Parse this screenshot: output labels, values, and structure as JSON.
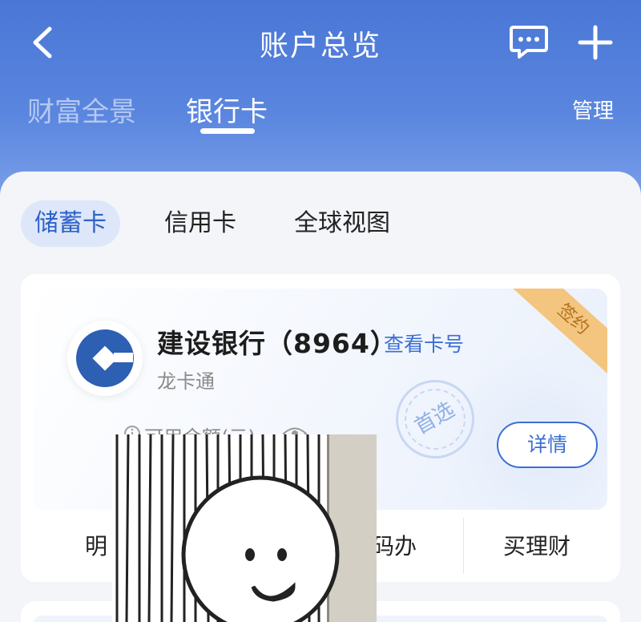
{
  "header": {
    "title": "账户总览",
    "tabs": [
      "财富全景",
      "银行卡"
    ],
    "active_tab": "银行卡",
    "manage_label": "管理"
  },
  "segments": {
    "items": [
      "储蓄卡",
      "信用卡",
      "全球视图"
    ],
    "active": "储蓄卡"
  },
  "card": {
    "bank_name": "建设银行（8964）",
    "view_card_number": "查看卡号",
    "card_type": "龙卡通",
    "badge": "签约",
    "stamp": "首选",
    "balance_label": "可用余额(元)",
    "detail_button": "详情",
    "actions": [
      "明细",
      "扫码办",
      "买理财"
    ],
    "visible_action_text": [
      "明",
      "扫码办",
      "买理财"
    ]
  },
  "colors": {
    "header_blue": "#4a77d6",
    "accent": "#3b6fd3",
    "badge": "#f3c57e"
  },
  "icons": {
    "back": "chevron-left-icon",
    "message": "message-icon",
    "add": "plus-icon",
    "info": "info-icon",
    "eye": "eye-icon",
    "bank_logo": "ccb-logo"
  }
}
